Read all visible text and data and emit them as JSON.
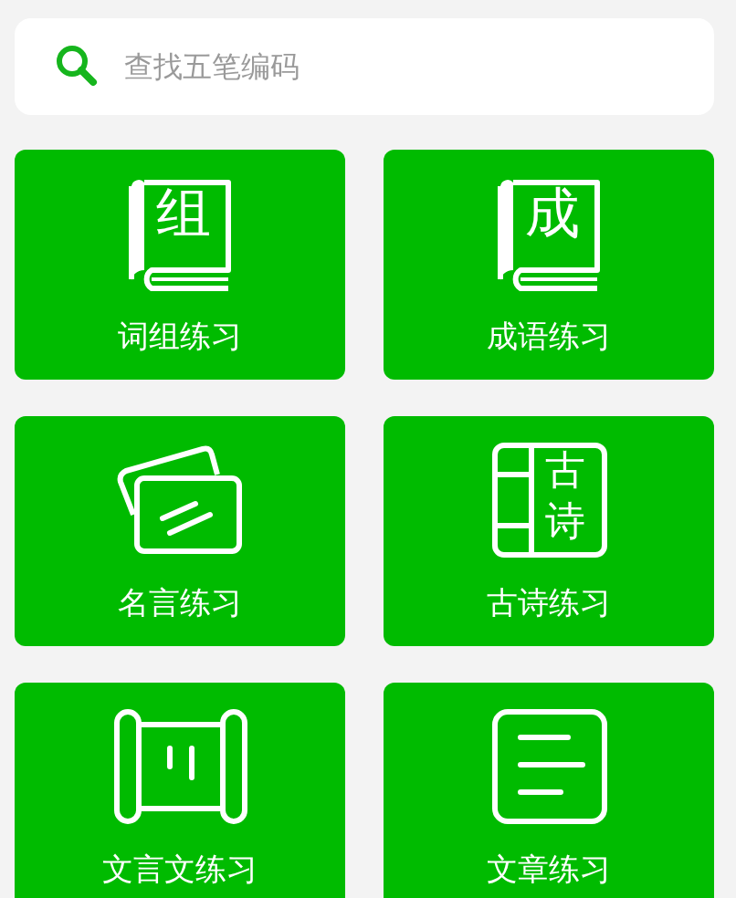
{
  "search": {
    "placeholder": "查找五笔编码"
  },
  "rows": [
    {
      "tiles": [
        {
          "kind": "book",
          "label": "词组练习",
          "glyphs": [
            "组"
          ]
        },
        {
          "kind": "book",
          "label": "成语练习",
          "glyphs": [
            "成"
          ]
        }
      ]
    },
    {
      "tiles": [
        {
          "kind": "cards",
          "label": "名言练习"
        },
        {
          "kind": "poem",
          "label": "古诗练习",
          "glyphs": [
            "古",
            "诗"
          ]
        }
      ]
    },
    {
      "tiles": [
        {
          "kind": "scroll",
          "label": "文言文练习"
        },
        {
          "kind": "document",
          "label": "文章练习"
        }
      ]
    }
  ]
}
